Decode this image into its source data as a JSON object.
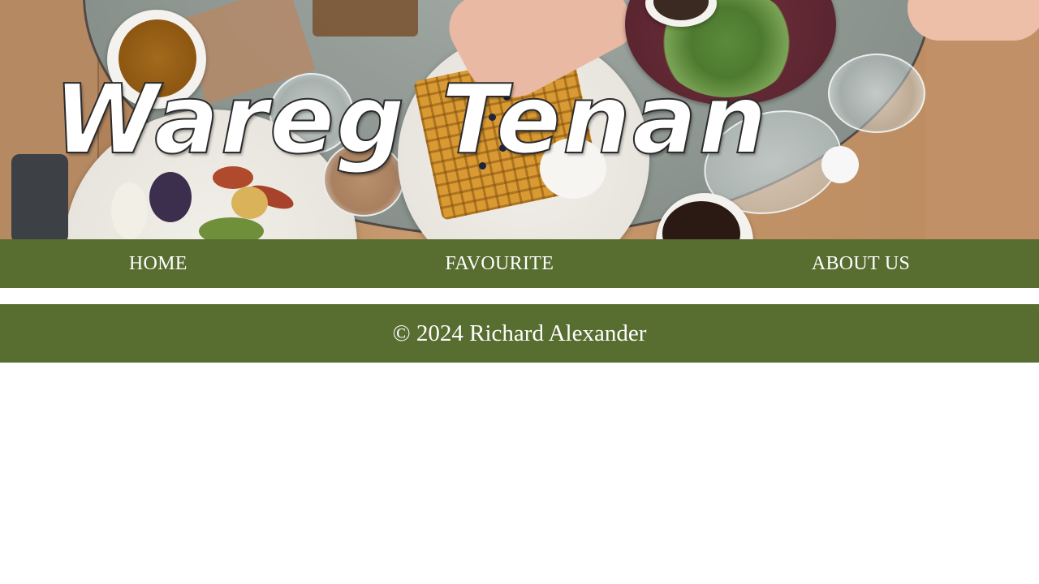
{
  "header": {
    "title": "Wareg Tenan",
    "background_image": "breakfast-table-photo"
  },
  "nav": {
    "items": [
      {
        "label": "HOME"
      },
      {
        "label": "FAVOURITE"
      },
      {
        "label": "ABOUT US"
      }
    ]
  },
  "footer": {
    "copyright": "© 2024 Richard Alexander"
  },
  "colors": {
    "nav_bg": "#586d30",
    "footer_bg": "#586d30",
    "text": "#ffffff"
  }
}
